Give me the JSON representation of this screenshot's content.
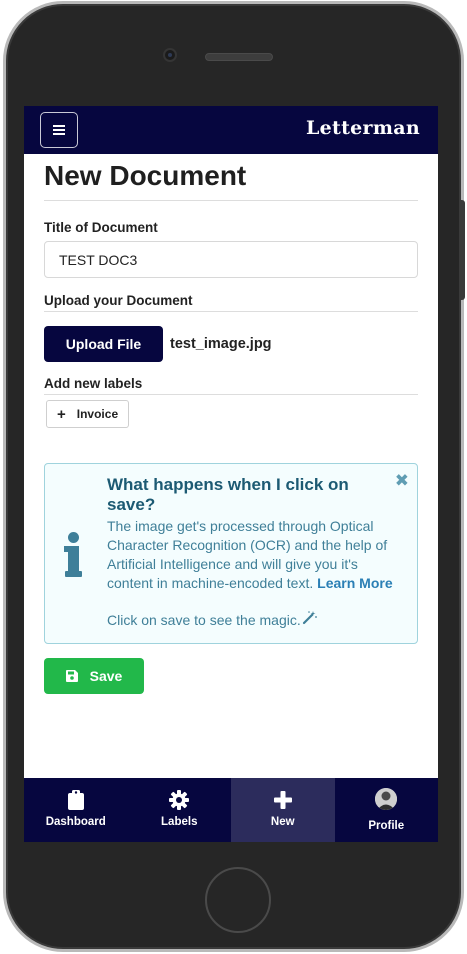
{
  "app": {
    "brand": "Letterman"
  },
  "page": {
    "title": "New Document"
  },
  "form": {
    "title_label": "Title of Document",
    "title_value": "TEST DOC3",
    "upload_label": "Upload your Document",
    "upload_button": "Upload File",
    "file_name": "test_image.jpg",
    "labels_label": "Add new labels",
    "label_chip": "Invoice",
    "save_button": "Save"
  },
  "info": {
    "heading": "What happens when I click on save?",
    "body": "The image get's processed through Optical Character Recognition (OCR) and the help of Artificial Intelligence and will give you it's content in machine-encoded text.",
    "link": "Learn More",
    "tail": "Click on save to see the magic."
  },
  "nav": {
    "items": [
      {
        "label": "Dashboard",
        "icon": "clipboard-icon"
      },
      {
        "label": "Labels",
        "icon": "gear-icon"
      },
      {
        "label": "New",
        "icon": "plus-icon"
      },
      {
        "label": "Profile",
        "icon": "avatar"
      }
    ],
    "active": "New"
  },
  "colors": {
    "navy": "#06063f",
    "save_green": "#22b84a",
    "info_bg": "#f4fdfe",
    "info_border": "#9fd3dd"
  }
}
